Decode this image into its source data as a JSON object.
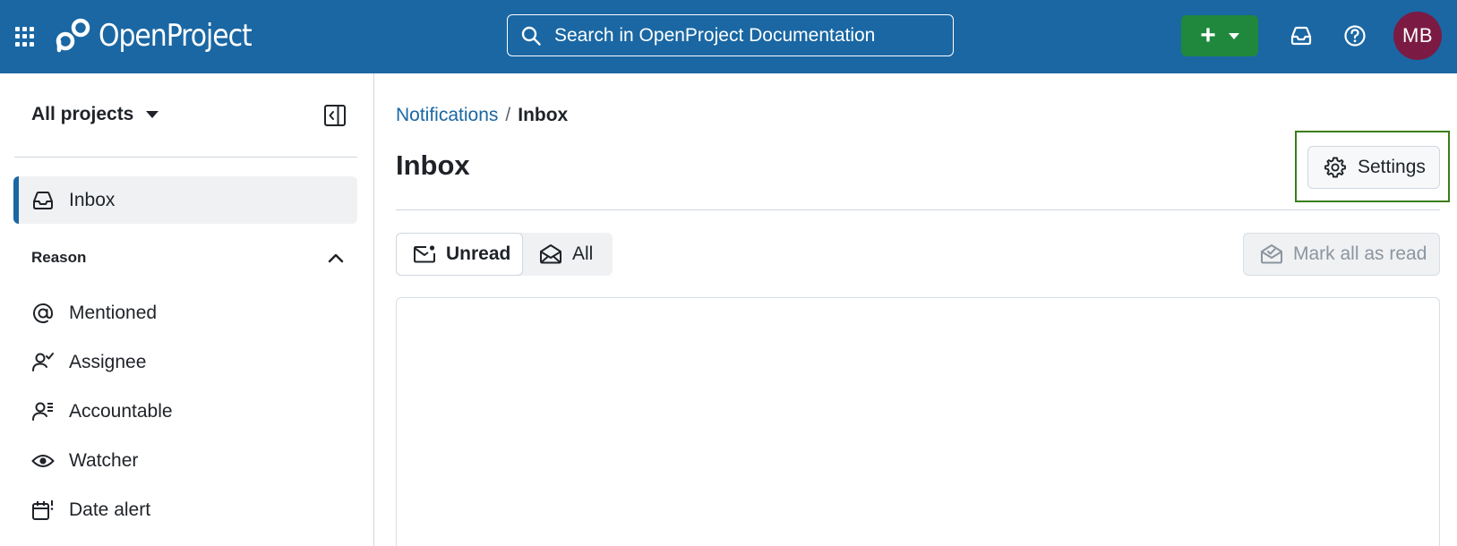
{
  "header": {
    "logo_text": "OpenProject",
    "search_placeholder": "Search in OpenProject Documentation",
    "create_label": "+",
    "avatar_initials": "MB",
    "colors": {
      "bar": "#1a67a3",
      "create": "#1f883d",
      "avatar": "#7b1b43"
    },
    "icons": [
      "apps-grid-icon",
      "openproject-logo-icon",
      "search-icon",
      "chevron-down-icon",
      "inbox-icon",
      "help-icon"
    ]
  },
  "sidebar": {
    "project_selector": "All projects",
    "inbox_label": "Inbox",
    "reason_heading": "Reason",
    "items": [
      {
        "label": "Mentioned",
        "icon": "mention-icon"
      },
      {
        "label": "Assignee",
        "icon": "person-check-icon"
      },
      {
        "label": "Accountable",
        "icon": "person-list-icon"
      },
      {
        "label": "Watcher",
        "icon": "eye-icon"
      },
      {
        "label": "Date alert",
        "icon": "calendar-alert-icon"
      }
    ]
  },
  "main": {
    "breadcrumb": {
      "parent": "Notifications",
      "separator": "/",
      "current": "Inbox"
    },
    "title": "Inbox",
    "settings_label": "Settings",
    "filters": {
      "unread": "Unread",
      "all": "All"
    },
    "mark_all_read": "Mark all as read",
    "highlight_color": "#3b7d16"
  }
}
